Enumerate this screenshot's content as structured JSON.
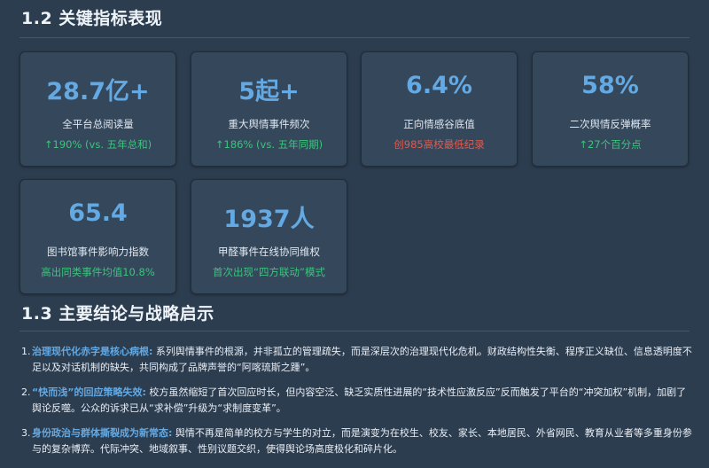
{
  "section1": {
    "title": "1.2 关键指标表现"
  },
  "cards": [
    {
      "value": "28.7亿+",
      "label": "全平台总阅读量",
      "delta": "↑190% (vs. 五年总和)",
      "delta_type": "up"
    },
    {
      "value": "5起+",
      "label": "重大舆情事件频次",
      "delta": "↑186% (vs. 五年同期)",
      "delta_type": "up"
    },
    {
      "value": "6.4%",
      "label": "正向情感谷底值",
      "delta": "创985高校最低纪录",
      "delta_type": "warn"
    },
    {
      "value": "58%",
      "label": "二次舆情反弹概率",
      "delta": "↑27个百分点",
      "delta_type": "up"
    },
    {
      "value": "65.4",
      "label": "图书馆事件影响力指数",
      "delta": "高出同类事件均值10.8%",
      "delta_type": "up"
    },
    {
      "value": "1937人",
      "label": "甲醛事件在线协同维权",
      "delta": "首次出现“四方联动”模式",
      "delta_type": "up"
    }
  ],
  "section2": {
    "title": "1.3 主要结论与战略启示"
  },
  "conclusions": [
    {
      "num": "1.",
      "head": "治理现代化赤字是核心病根:",
      "body": " 系列舆情事件的根源，并非孤立的管理疏失，而是深层次的治理现代化危机。财政结构性失衡、程序正义缺位、信息透明度不足以及对话机制的缺失，共同构成了品牌声誉的“阿喀琉斯之踵”。"
    },
    {
      "num": "2.",
      "head": "“快而浅”的回应策略失效:",
      "body": " 校方虽然缩短了首次回应时长，但内容空泛、缺乏实质性进展的“技术性应激反应”反而触发了平台的“冲突加权”机制，加剧了舆论反噬。公众的诉求已从“求补偿”升级为“求制度变革”。"
    },
    {
      "num": "3.",
      "head": "身份政治与群体撕裂成为新常态:",
      "body": " 舆情不再是简单的校方与学生的对立，而是演变为在校生、校友、家长、本地居民、外省网民、教育从业者等多重身份参与的复杂博弈。代际冲突、地域叙事、性别议题交织，使得舆论场高度极化和碎片化。"
    }
  ],
  "colors": {
    "background": "#2d3d50",
    "card": "#34475b",
    "accent": "#63a9e3",
    "up": "#3cc47d",
    "warn": "#e25a4d"
  }
}
